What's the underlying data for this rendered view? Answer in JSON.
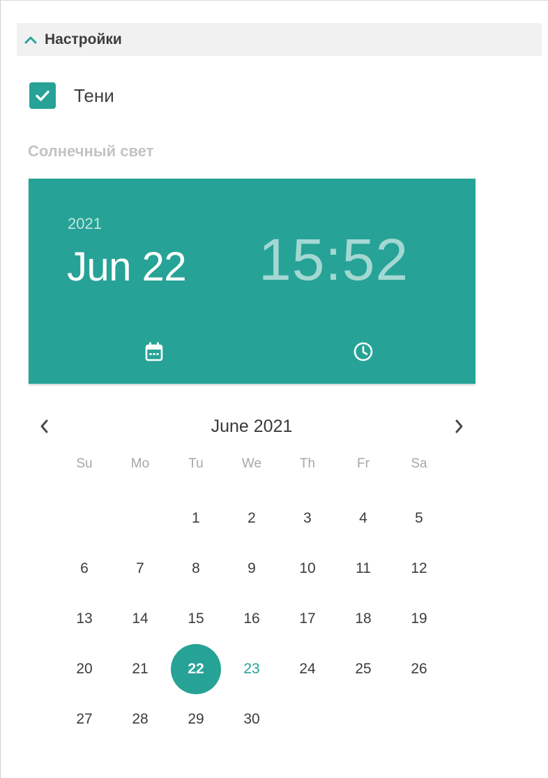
{
  "section": {
    "title": "Настройки",
    "toggle_icon": "chevron-up-icon"
  },
  "shadows_checkbox": {
    "label": "Тени",
    "checked": true
  },
  "sunlight_label": "Солнечный свет",
  "picker_header": {
    "year": "2021",
    "date": "Jun 22",
    "time": "15:52",
    "date_tab_icon": "calendar-icon",
    "time_tab_icon": "clock-icon"
  },
  "calendar": {
    "month_label": "June 2021",
    "prev_icon": "chevron-left-icon",
    "next_icon": "chevron-right-icon",
    "weekdays": [
      "Su",
      "Mo",
      "Tu",
      "We",
      "Th",
      "Fr",
      "Sa"
    ],
    "days": [
      "",
      "",
      "1",
      "2",
      "3",
      "4",
      "5",
      "6",
      "7",
      "8",
      "9",
      "10",
      "11",
      "12",
      "13",
      "14",
      "15",
      "16",
      "17",
      "18",
      "19",
      "20",
      "21",
      "22",
      "23",
      "24",
      "25",
      "26",
      "27",
      "28",
      "29",
      "30"
    ],
    "selected_day": "22",
    "today_day": "23"
  },
  "colors": {
    "accent": "#26a396",
    "header_bg": "#f1f1f1",
    "muted_label": "#c3c3c3"
  }
}
